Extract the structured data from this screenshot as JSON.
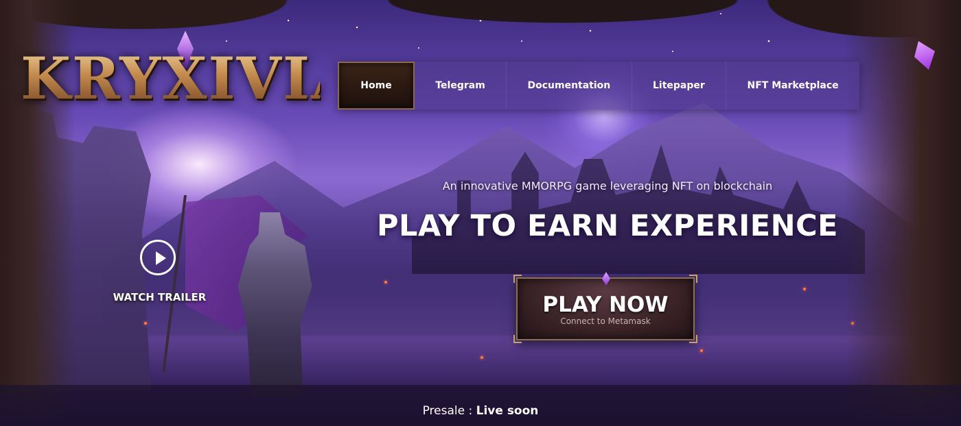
{
  "brand": {
    "logo_text": "KRYXIVIA"
  },
  "nav": {
    "items": [
      {
        "label": "Home",
        "active": true
      },
      {
        "label": "Telegram",
        "active": false
      },
      {
        "label": "Documentation",
        "active": false
      },
      {
        "label": "Litepaper",
        "active": false
      },
      {
        "label": "NFT Marketplace",
        "active": false
      }
    ]
  },
  "hero": {
    "tagline": "An innovative MMORPG game leveraging NFT on blockchain",
    "headline": "PLAY TO EARN EXPERIENCE",
    "play_button": {
      "label": "PLAY NOW",
      "sublabel": "Connect to Metamask"
    },
    "trailer": {
      "label": "WATCH TRAILER",
      "icon": "play-circle-icon"
    }
  },
  "presale": {
    "label": "Presale",
    "separator": " : ",
    "status": "Live soon"
  },
  "colors": {
    "accent": "#c79a5c",
    "nav_bg": "#50388c",
    "button_bg": "#3a2226"
  }
}
